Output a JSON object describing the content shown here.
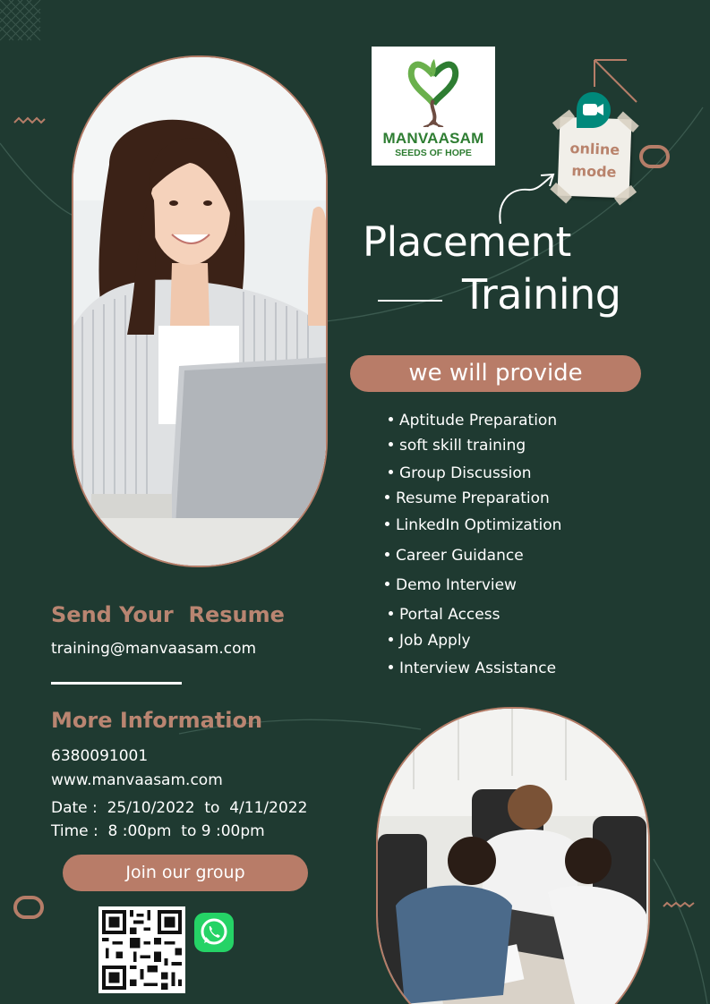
{
  "brand": {
    "name": "MANVAASAM",
    "tagline": "SEEDS OF HOPE"
  },
  "mode_note": {
    "text": "online\nmode",
    "icon": "video-camera-icon"
  },
  "headline": {
    "line1": "Placement",
    "line2": "Training"
  },
  "provide": {
    "label": "we will provide",
    "items": [
      "Aptitude Preparation",
      "soft skill training",
      "Group Discussion",
      "Resume Preparation",
      "LinkedIn Optimization",
      "Career Guidance",
      "Demo Interview",
      "Portal Access",
      "Job Apply",
      "Interview Assistance"
    ]
  },
  "resume": {
    "heading": "Send Your  Resume",
    "email": "training@manvaasam.com"
  },
  "more_info": {
    "heading": "More Information",
    "phone": "6380091001",
    "website": "www.manvaasam.com",
    "date": "Date :  25/10/2022  to  4/11/2022",
    "time": "Time :  8 :00pm  to 9 :00pm"
  },
  "join": {
    "label": "Join our group"
  },
  "colors": {
    "background": "#1f3a31",
    "accent": "#b87c68",
    "text": "#ffffff",
    "logo_green": "#2e7d32",
    "whatsapp": "#25d366"
  }
}
